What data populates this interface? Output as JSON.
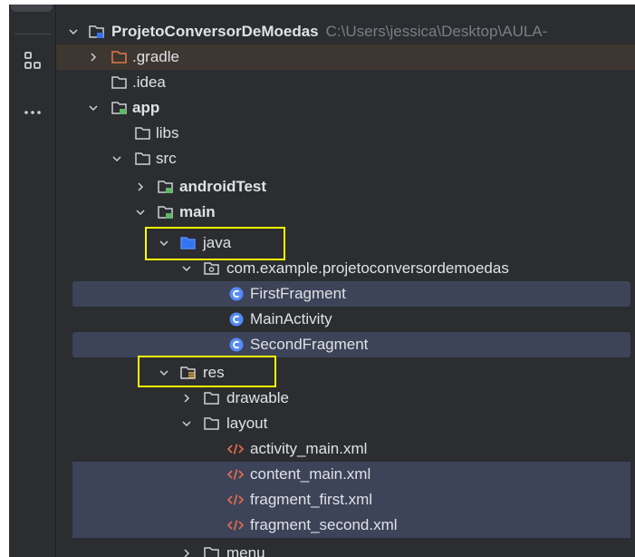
{
  "colors": {
    "selection": "#3d4459",
    "excluded": "#3e3630",
    "highlight": "#ffff00",
    "class_icon": "#548af7",
    "xml_icon": "#e06c4a"
  },
  "tool_strip": {
    "icons": [
      "structure-icon",
      "more-icon"
    ]
  },
  "tree": {
    "project": {
      "name": "ProjetoConversorDeMoedas",
      "path": "C:\\Users\\jessica\\Desktop\\AULA-"
    },
    "gradle": ".gradle",
    "idea": ".idea",
    "app": "app",
    "libs": "libs",
    "src": "src",
    "androidTest": "androidTest",
    "main": "main",
    "java": "java",
    "package": "com.example.projetoconversordemoedas",
    "classes": [
      "FirstFragment",
      "MainActivity",
      "SecondFragment"
    ],
    "res": "res",
    "drawable": "drawable",
    "layout": "layout",
    "xml_files": [
      "activity_main.xml",
      "content_main.xml",
      "fragment_first.xml",
      "fragment_second.xml"
    ],
    "menu": "menu"
  }
}
